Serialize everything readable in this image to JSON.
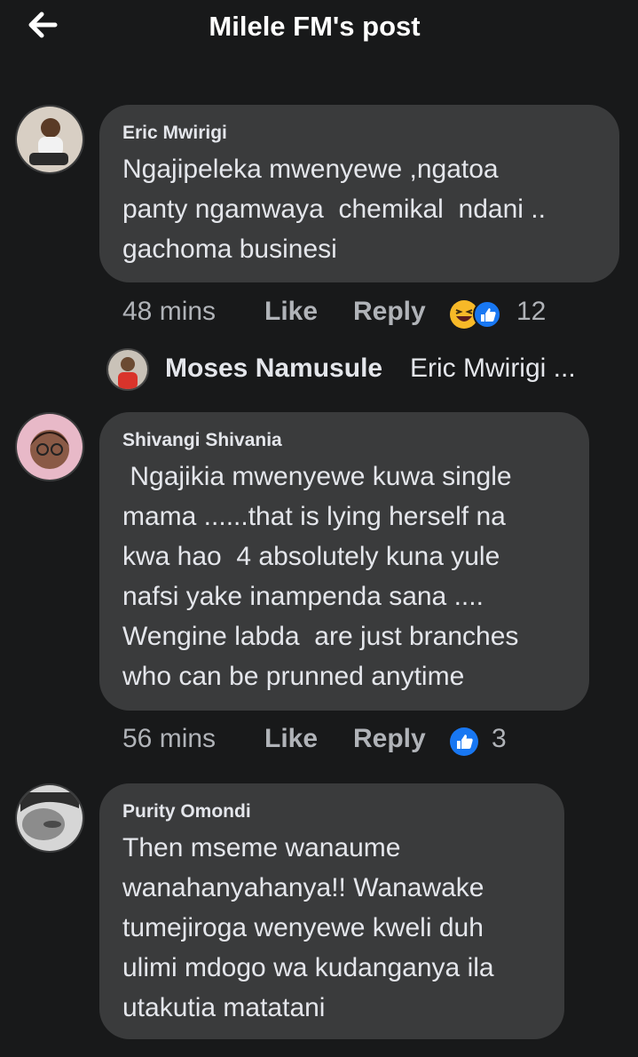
{
  "header": {
    "title": "Milele FM's post"
  },
  "comments": [
    {
      "author": "Eric Mwirigi",
      "text": "Ngajipeleka mwenyewe ,ngatoa\npanty ngamwaya  chemikal  ndani ..\ngachoma businesi",
      "time": "48 mins",
      "like": "Like",
      "reply": "Reply",
      "reaction_count": "12",
      "reactions": [
        "haha-icon",
        "like-icon"
      ]
    },
    {
      "author": "Shivangi Shivania",
      "text": " Ngajikia mwenyewe kuwa single\nmama ......that is lying herself na\nkwa hao  4 absolutely kuna yule\nnafsi yake inampenda sana ....\nWengine labda  are just branches\nwho can be prunned anytime",
      "time": "56 mins",
      "like": "Like",
      "reply": "Reply",
      "reaction_count": "3",
      "reactions": [
        "like-icon"
      ]
    },
    {
      "author": "Purity Omondi",
      "text": "Then mseme wanaume\nwanahanyahanya!! Wanawake\ntumejiroga wenyewe kweli duh\nulimi mdogo wa kudanganya ila\nutakutia matatani"
    }
  ],
  "reply_preview": {
    "author": "Moses Namusule",
    "text": "Eric Mwirigi ..."
  },
  "colors": {
    "background": "#18191a",
    "bubble": "#3a3b3c",
    "secondary_text": "#b0b3b8",
    "like_blue": "#1877f2",
    "haha_yellow": "#f7b928"
  }
}
